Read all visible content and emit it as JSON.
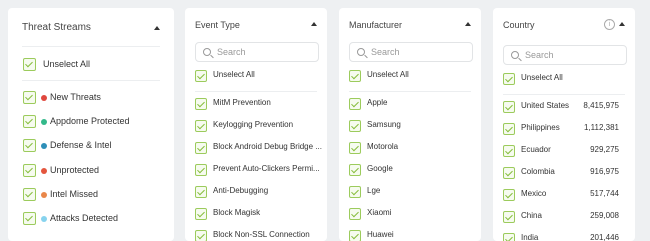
{
  "threat_streams": {
    "title": "Threat Streams",
    "unselect_all": "Unselect All",
    "items": [
      {
        "label": "New Threats",
        "color": "#e0483e"
      },
      {
        "label": "Appdome Protected",
        "color": "#33b98a"
      },
      {
        "label": "Defense & Intel",
        "color": "#2e8fb8"
      },
      {
        "label": "Unprotected",
        "color": "#e4553d"
      },
      {
        "label": "Intel Missed",
        "color": "#e9874a"
      },
      {
        "label": "Attacks Detected",
        "color": "#87d3ee"
      }
    ]
  },
  "event_type": {
    "title": "Event Type",
    "search_placeholder": "Search",
    "unselect_all": "Unselect All",
    "items": [
      "MitM Prevention",
      "Keylogging Prevention",
      "Block Android Debug Bridge ...",
      "Prevent Auto-Clickers Permi...",
      "Anti-Debugging",
      "Block Magisk",
      "Block Non-SSL Connection"
    ]
  },
  "manufacturer": {
    "title": "Manufacturer",
    "search_placeholder": "Search",
    "unselect_all": "Unselect All",
    "items": [
      "Apple",
      "Samsung",
      "Motorola",
      "Google",
      "Lge",
      "Xiaomi",
      "Huawei"
    ]
  },
  "country": {
    "title": "Country",
    "info_icon": "i",
    "search_placeholder": "Search",
    "unselect_all": "Unselect All",
    "items": [
      {
        "name": "United States",
        "count": "8,415,975"
      },
      {
        "name": "Philippines",
        "count": "1,112,381"
      },
      {
        "name": "Ecuador",
        "count": "929,275"
      },
      {
        "name": "Colombia",
        "count": "916,975"
      },
      {
        "name": "Mexico",
        "count": "517,744"
      },
      {
        "name": "China",
        "count": "259,008"
      },
      {
        "name": "India",
        "count": "201,446"
      }
    ]
  },
  "icons": {
    "search": "search-icon",
    "caret": "caret-up-icon",
    "checkbox": "checkbox-checked-icon",
    "info": "info-icon"
  },
  "accent_color": "#86bd3c"
}
